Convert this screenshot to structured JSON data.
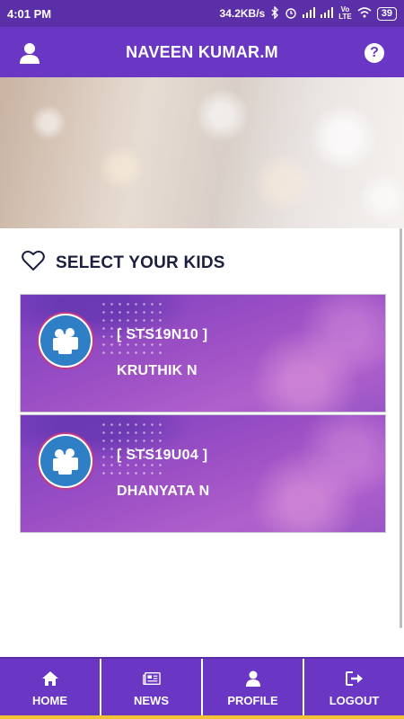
{
  "status_bar": {
    "time": "4:01 PM",
    "network_speed": "34.2KB/s",
    "battery": "39",
    "icons": [
      "bluetooth-icon",
      "alarm-icon",
      "signal-icon",
      "volte-icon",
      "wifi-icon",
      "battery-icon"
    ]
  },
  "app_bar": {
    "title": "NAVEEN KUMAR.M",
    "left_icon": "user-icon",
    "right_icon": "help-icon",
    "help_glyph": "?"
  },
  "section": {
    "title": "SELECT YOUR KIDS",
    "icon": "heart-outline-icon"
  },
  "kids": [
    {
      "id": "[ STS19N10 ]",
      "name": "KRUTHIK N"
    },
    {
      "id": "[ STS19U04 ]",
      "name": "DHANYATA N"
    }
  ],
  "bottom_nav": {
    "items": [
      {
        "label": "HOME",
        "icon": "home-icon"
      },
      {
        "label": "NEWS",
        "icon": "newspaper-icon"
      },
      {
        "label": "PROFILE",
        "icon": "person-icon"
      },
      {
        "label": "LOGOUT",
        "icon": "logout-icon"
      }
    ]
  },
  "colors": {
    "primary": "#6a36c4",
    "status_bar": "#5b2fa8",
    "card": "#9b4fc4",
    "title_text": "#1c1f3f",
    "accent_strip": "#f1c232"
  }
}
